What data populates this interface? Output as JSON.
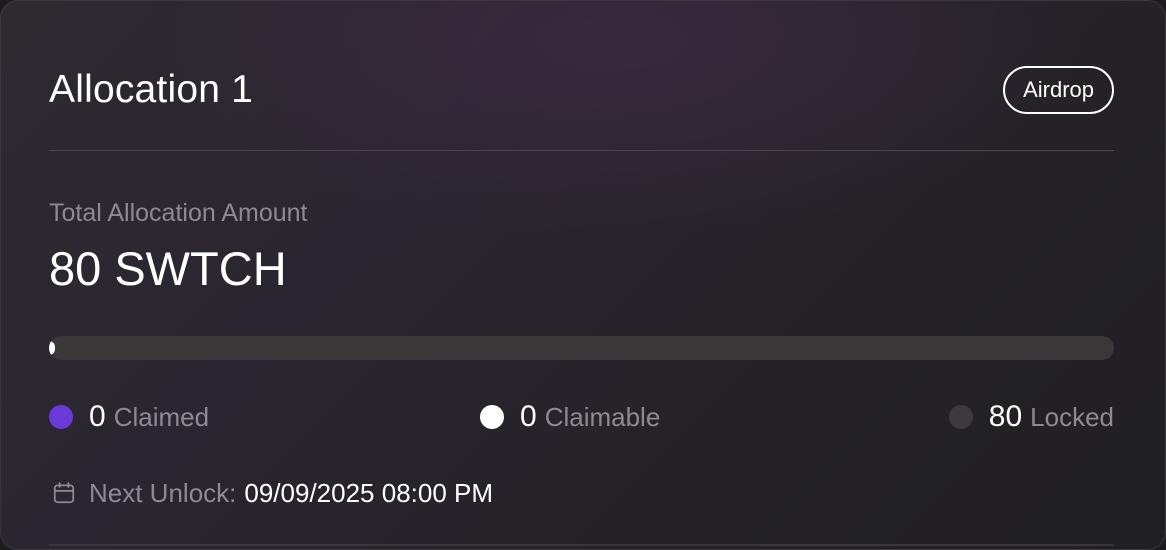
{
  "card": {
    "title": "Allocation 1",
    "badge": "Airdrop"
  },
  "total": {
    "label": "Total Allocation Amount",
    "amount": "80 SWTCH"
  },
  "progress": {
    "claimed_fraction": 0,
    "claimable_fraction": 0,
    "locked_fraction": 1
  },
  "legend": {
    "claimed": {
      "value": "0",
      "label": "Claimed",
      "color": "#6a3ad8"
    },
    "claimable": {
      "value": "0",
      "label": "Claimable",
      "color": "#ffffff"
    },
    "locked": {
      "value": "80",
      "label": "Locked",
      "color": "#3d3a3e"
    }
  },
  "next_unlock": {
    "label": "Next Unlock:",
    "value": "09/09/2025 08:00 PM",
    "icon": "calendar-icon"
  }
}
